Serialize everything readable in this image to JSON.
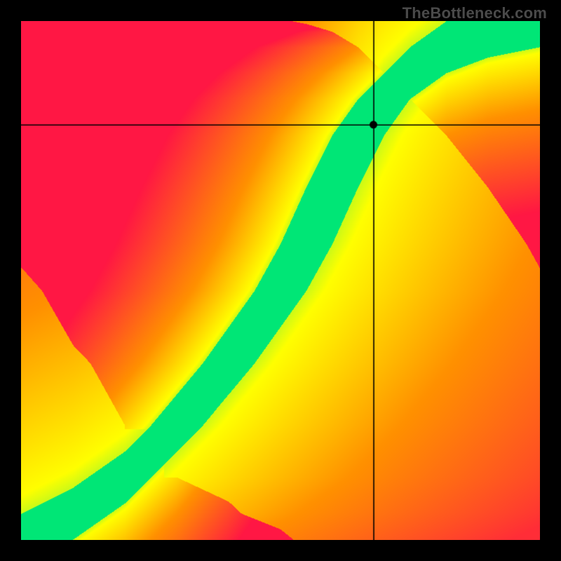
{
  "watermark": "TheBottleneck.com",
  "colors": {
    "low": "#ff1744",
    "mid_low": "#ff9100",
    "mid": "#ffea00",
    "mid_high": "#ffff00",
    "good": "#00e676",
    "crosshair": "#000000",
    "marker": "#000000",
    "background": "#000000"
  },
  "chart_data": {
    "type": "heatmap",
    "title": "",
    "xlabel": "",
    "ylabel": "",
    "xlim": [
      0,
      1
    ],
    "ylim": [
      0,
      1
    ],
    "crosshair": {
      "x": 0.68,
      "y": 0.8
    },
    "marker": {
      "x": 0.68,
      "y": 0.8
    },
    "ideal_curve": [
      {
        "x": 0.0,
        "y": 0.0
      },
      {
        "x": 0.1,
        "y": 0.05
      },
      {
        "x": 0.2,
        "y": 0.12
      },
      {
        "x": 0.3,
        "y": 0.22
      },
      {
        "x": 0.4,
        "y": 0.34
      },
      {
        "x": 0.5,
        "y": 0.48
      },
      {
        "x": 0.55,
        "y": 0.57
      },
      {
        "x": 0.6,
        "y": 0.68
      },
      {
        "x": 0.65,
        "y": 0.78
      },
      {
        "x": 0.7,
        "y": 0.85
      },
      {
        "x": 0.75,
        "y": 0.9
      },
      {
        "x": 0.82,
        "y": 0.95
      },
      {
        "x": 0.9,
        "y": 0.98
      },
      {
        "x": 1.0,
        "y": 1.0
      }
    ],
    "band_half_width": 0.05,
    "left_falloff": 0.38,
    "right_falloff": 0.9
  }
}
